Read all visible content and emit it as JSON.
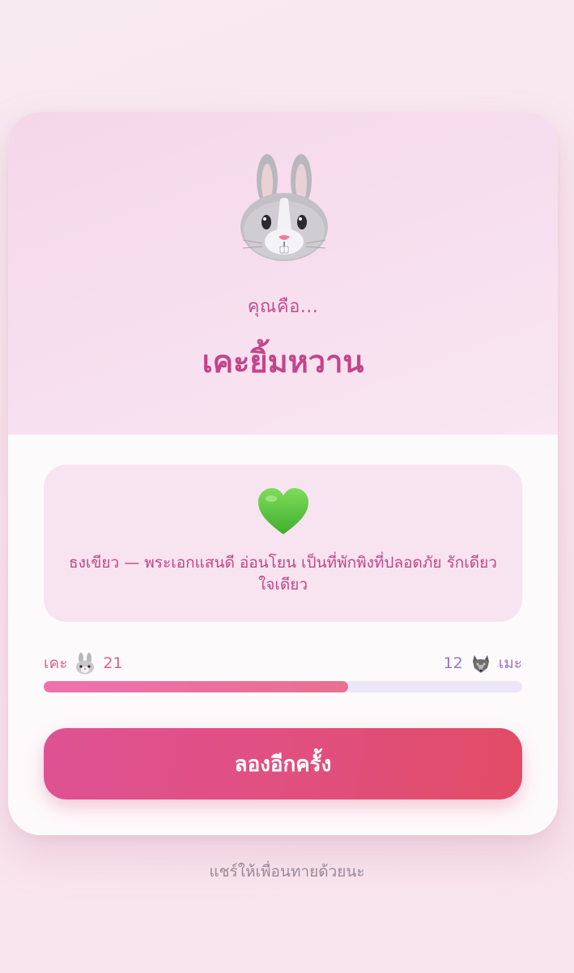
{
  "result": {
    "avatar_icon": "rabbit-face-icon",
    "subtitle": "คุณคือ...",
    "title": "เคะยิ้มหวาน"
  },
  "description": {
    "icon": "green-heart-icon",
    "text": "ธงเขียว — พระเอกแสนดี อ่อนโยน เป็นที่พักพิงที่ปลอดภัย รักเดียวใจเดียว"
  },
  "score": {
    "left_label": "เคะ",
    "left_icon": "rabbit-face-icon",
    "left_value": "21",
    "right_value": "12",
    "right_icon": "wolf-face-icon",
    "right_label": "เมะ",
    "fill_fraction": 0.636
  },
  "actions": {
    "retry_label": "ลองอีกครั้ง"
  },
  "footer": {
    "share_text": "แชร์ให้เพื่อนทายด้วยนะ"
  },
  "colors": {
    "accent": "#c4448a",
    "button_start": "#df5293",
    "button_end": "#e24c65",
    "bar_track": "#ece6f8",
    "meh_color": "#9a72d4"
  }
}
